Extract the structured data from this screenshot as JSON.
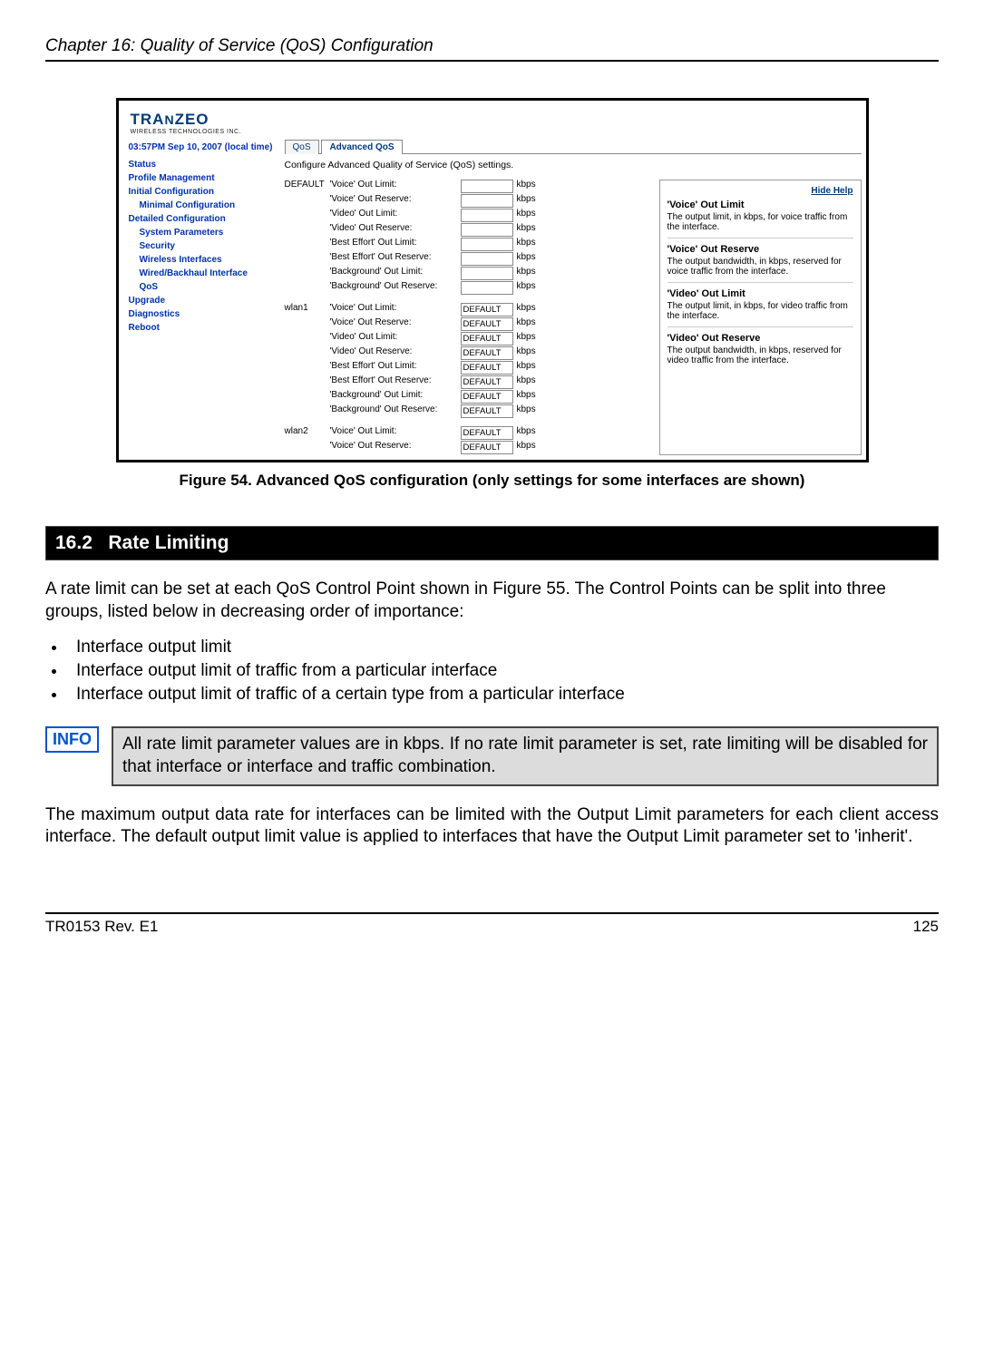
{
  "header": {
    "chapter": "Chapter 16: Quality of Service (QoS) Configuration"
  },
  "figure": {
    "logo_line1": "TRANZEO",
    "logo_line2": "WIRELESS  TECHNOLOGIES INC.",
    "datetime": "03:57PM Sep 10, 2007 (local time)",
    "side_links": {
      "status": "Status",
      "profile": "Profile Management",
      "init": "Initial Configuration",
      "mincfg": "Minimal Configuration",
      "detcfg": "Detailed Configuration",
      "sysparams": "System Parameters",
      "security": "Security",
      "wifaces": "Wireless Interfaces",
      "backhaul": "Wired/Backhaul Interface",
      "qos": "QoS",
      "upgrade": "Upgrade",
      "diag": "Diagnostics",
      "reboot": "Reboot"
    },
    "tabs": {
      "qos": "QoS",
      "advqos": "Advanced QoS"
    },
    "description": "Configure Advanced Quality of Service (QoS) settings.",
    "groups": {
      "default_label": "DEFAULT",
      "wlan1_label": "wlan1",
      "wlan2_label": "wlan2"
    },
    "row_labels": {
      "voice_out_limit": "'Voice' Out Limit:",
      "voice_out_reserve": "'Voice' Out Reserve:",
      "video_out_limit": "'Video' Out Limit:",
      "video_out_reserve": "'Video' Out Reserve:",
      "best_out_limit": "'Best Effort' Out Limit:",
      "best_out_reserve": "'Best Effort' Out Reserve:",
      "bg_out_limit": "'Background' Out Limit:",
      "bg_out_reserve": "'Background' Out Reserve:"
    },
    "unit": "kbps",
    "default_value": "DEFAULT",
    "help": {
      "hide": "Hide Help",
      "h1": "'Voice' Out Limit",
      "t1": "The output limit, in kbps, for voice traffic from the interface.",
      "h2": "'Voice' Out Reserve",
      "t2": "The output bandwidth, in kbps, reserved for voice traffic from the interface.",
      "h3": "'Video' Out Limit",
      "t3": "The output limit, in kbps, for video traffic from the interface.",
      "h4": "'Video' Out Reserve",
      "t4": "The output bandwidth, in kbps, reserved for video traffic from the interface."
    },
    "caption": "Figure 54. Advanced QoS configuration (only settings for some interfaces are shown)"
  },
  "section": {
    "num": "16.2",
    "title": "Rate Limiting"
  },
  "p1": "A rate limit can be set at each QoS Control Point shown in Figure 55. The Control Points can be split into three groups, listed below in decreasing order of importance:",
  "bullets": {
    "b1": "Interface output limit",
    "b2": "Interface output limit of traffic from a particular interface",
    "b3": "Interface output limit of traffic of a certain type from a particular interface"
  },
  "info": {
    "badge": "INFO",
    "text": "All rate limit parameter values are in kbps. If no rate limit parameter is set, rate limiting will be disabled for that interface or interface and traffic combination."
  },
  "p2": "The maximum output data rate for interfaces can be limited with the Output Limit parameters for each client access interface. The default output limit value is applied to interfaces that have the Output Limit parameter set to 'inherit'.",
  "footer": {
    "left": "TR0153 Rev. E1",
    "right": "125"
  }
}
